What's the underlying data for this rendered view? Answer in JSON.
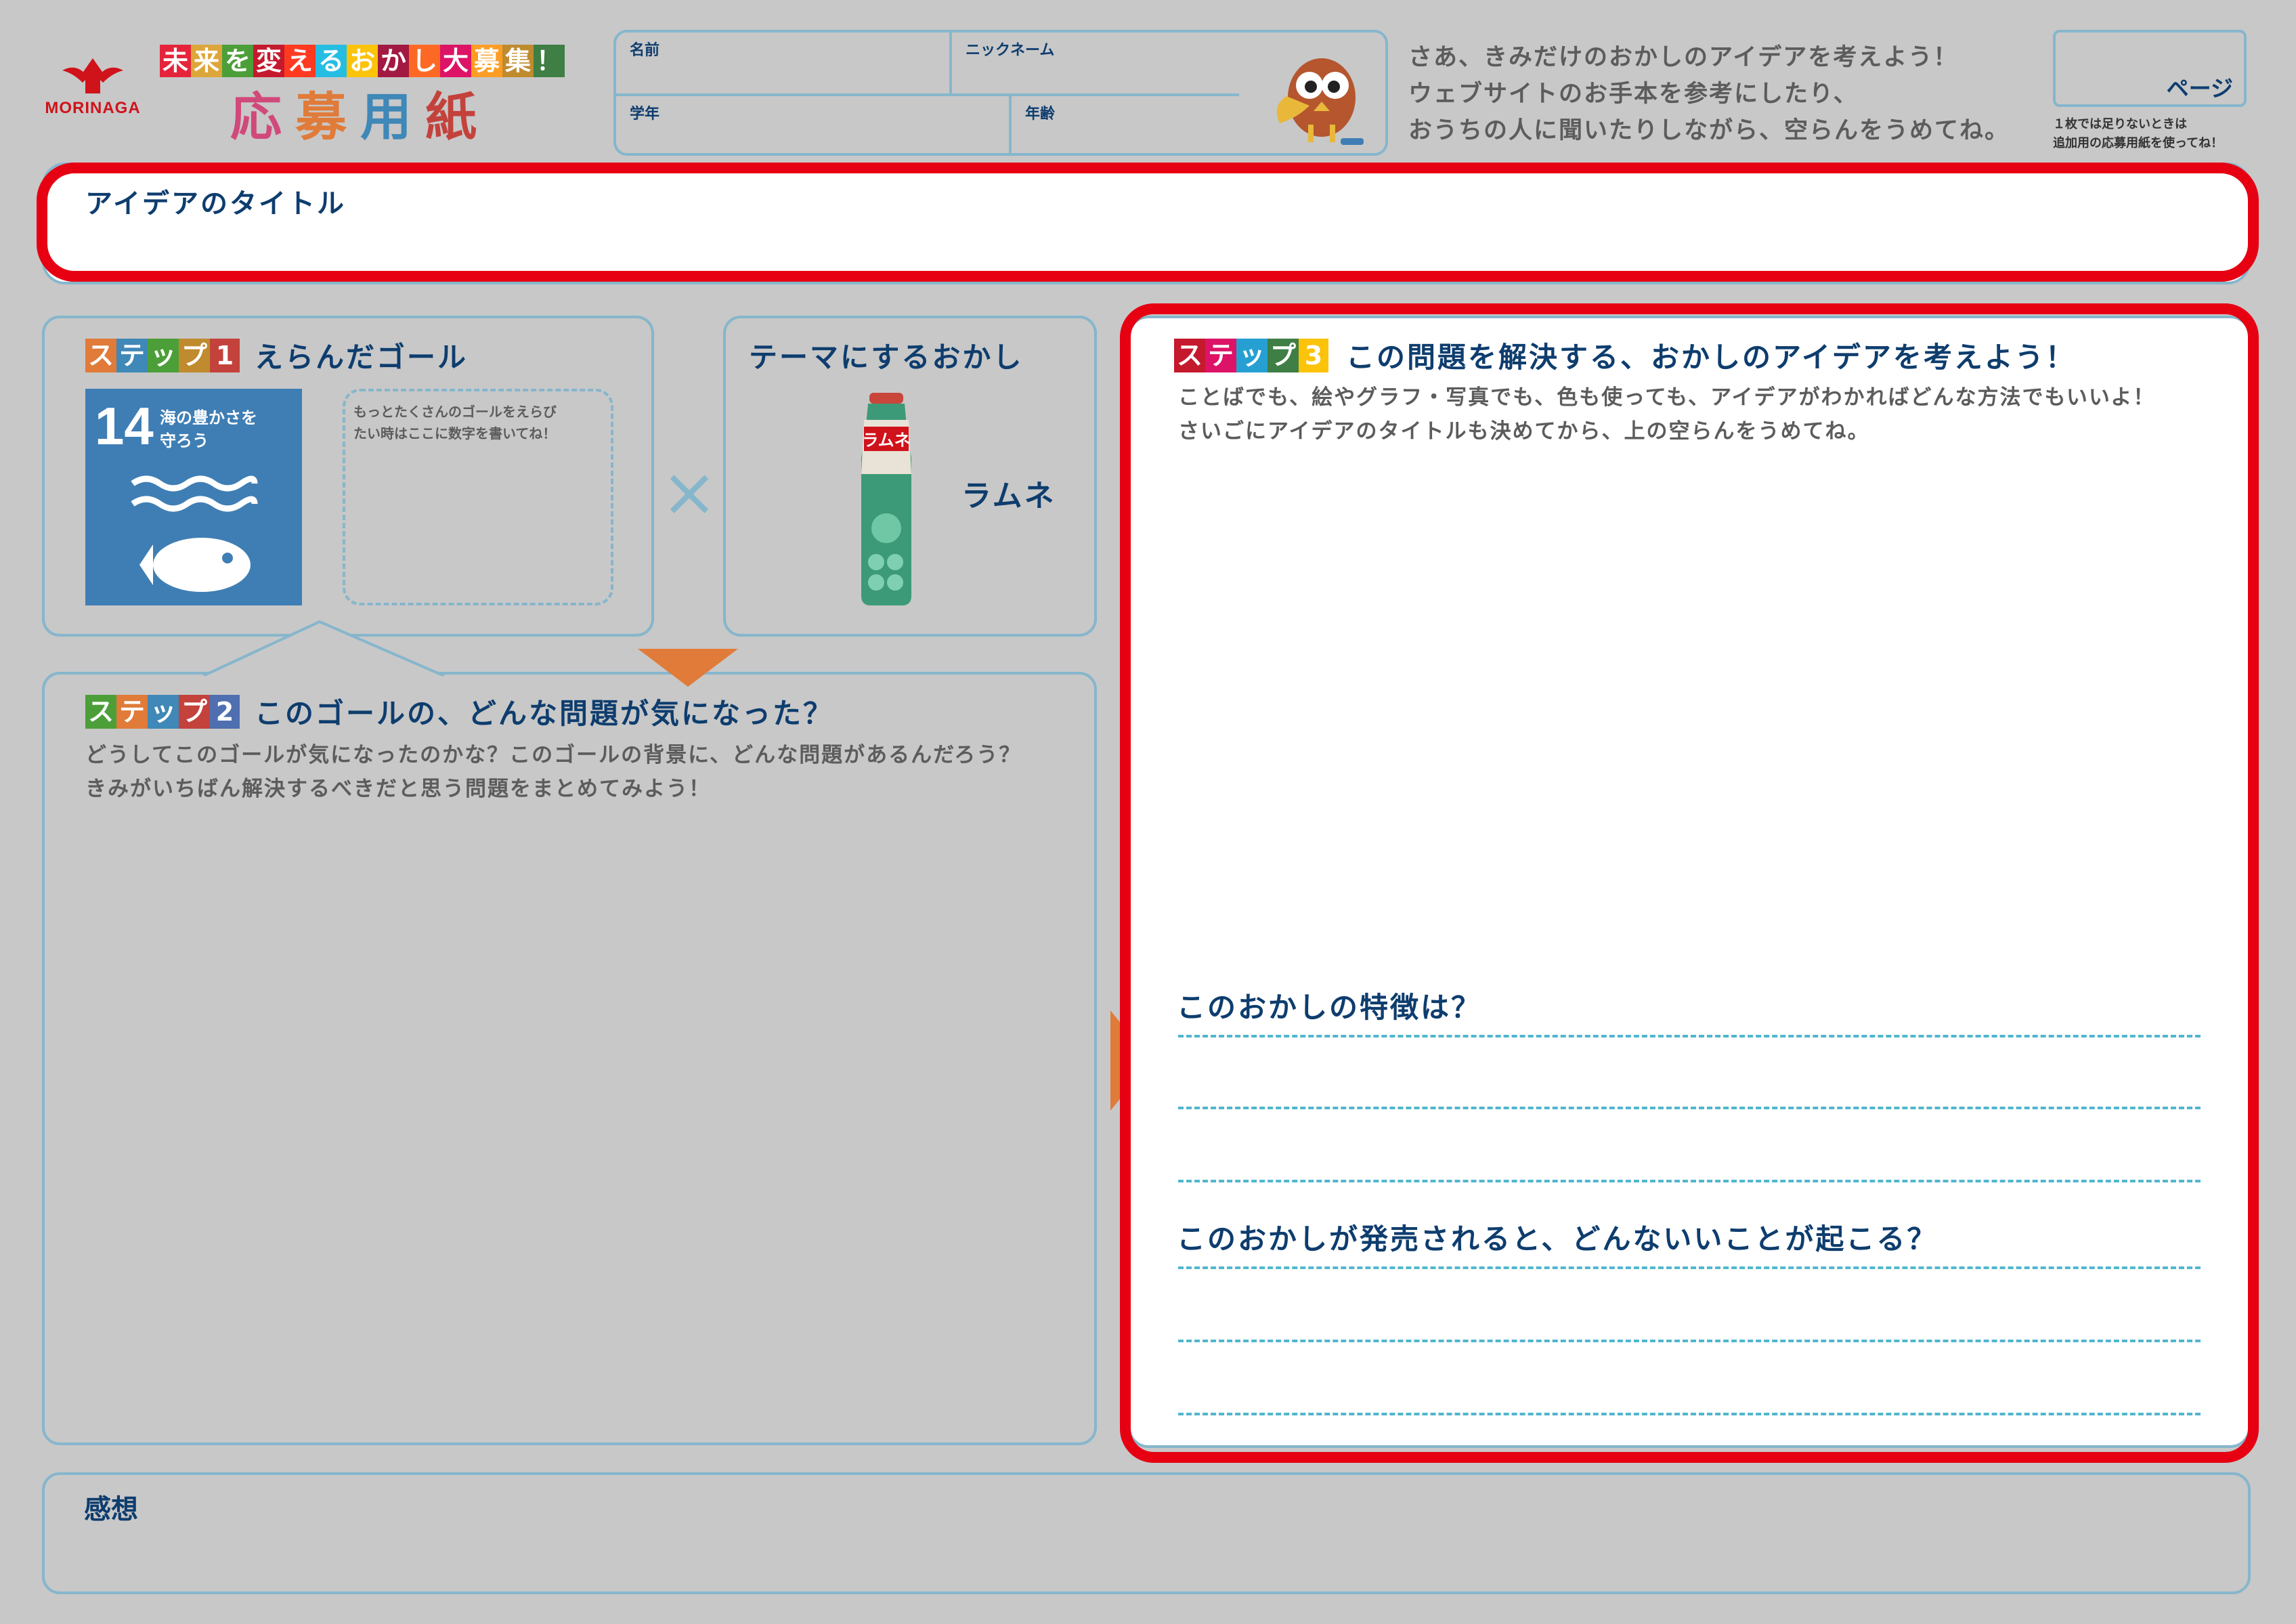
{
  "header": {
    "logo_text": "MORINAGA",
    "campaign_chars": [
      {
        "ch": "未",
        "bg": "#e5243b"
      },
      {
        "ch": "来",
        "bg": "#dda63a"
      },
      {
        "ch": "を",
        "bg": "#4c9f38"
      },
      {
        "ch": "変",
        "bg": "#c5192d"
      },
      {
        "ch": "え",
        "bg": "#ff3a21"
      },
      {
        "ch": "る",
        "bg": "#26bde2"
      },
      {
        "ch": "お",
        "bg": "#fcc30b"
      },
      {
        "ch": "か",
        "bg": "#a21942"
      },
      {
        "ch": "し",
        "bg": "#fd6925"
      },
      {
        "ch": "大",
        "bg": "#dd1367"
      },
      {
        "ch": "募",
        "bg": "#fd9d24"
      },
      {
        "ch": "集",
        "bg": "#bf8b2e"
      },
      {
        "ch": "！",
        "bg": "#3f7e44"
      }
    ],
    "title_chars": [
      {
        "ch": "応",
        "color": "#d1497b"
      },
      {
        "ch": "募",
        "color": "#e07b39"
      },
      {
        "ch": "用",
        "color": "#3f88b8"
      },
      {
        "ch": "紙",
        "color": "#c4423c"
      }
    ],
    "name_label": "名前",
    "nickname_label": "ニックネーム",
    "grade_label": "学年",
    "age_label": "年齢",
    "instructions": [
      "さあ、きみだけのおかしのアイデアを考えよう！",
      "ウェブサイトのお手本を参考にしたり、",
      "おうちの人に聞いたりしながら、空らんをうめてね。"
    ],
    "page_label": "ページ",
    "page_note_1": "１枚では足りないときは",
    "page_note_2": "追加用の応募用紙を使ってね！"
  },
  "idea_title_label": "アイデアのタイトル",
  "step_word": [
    "ス",
    "テ",
    "ッ",
    "プ"
  ],
  "step1": {
    "number": "1",
    "colors": [
      "#e07b39",
      "#3f88b8",
      "#4c9f38",
      "#bf8b2e",
      "#c4423c"
    ],
    "heading": "えらんだゴール",
    "goal_number": "14",
    "goal_line_1": "海の豊かさを",
    "goal_line_2": "守ろう",
    "goal_color": "#3f7eb4",
    "note_line_1": "もっとたくさんのゴールをえらび",
    "note_line_2": "たい時はここに数字を書いてね！"
  },
  "times_symbol": "×",
  "theme": {
    "heading": "テーマにするおかし",
    "product_name": "ラムネ",
    "bottle_label": "ラムネ"
  },
  "step2": {
    "number": "2",
    "colors": [
      "#4c9f38",
      "#e07b39",
      "#3f88b8",
      "#c4423c",
      "#4f6fb0"
    ],
    "heading": "このゴールの、どんな問題が気になった？",
    "desc_1": "どうしてこのゴールが気になったのかな？このゴールの背景に、どんな問題があるんだろう？",
    "desc_2": "きみがいちばん解決するべきだと思う問題をまとめてみよう！"
  },
  "step3": {
    "number": "3",
    "colors": [
      "#c5192d",
      "#dd1367",
      "#26a0d2",
      "#3f7e44",
      "#fcc30b"
    ],
    "heading": "この問題を解決する、おかしのアイデアを考えよう！",
    "desc_1": "ことばでも、絵やグラフ・写真でも、色も使っても、アイデアがわかればどんな方法でもいいよ！",
    "desc_2": "さいごにアイデアのタイトルも決めてから、上の空らんをうめてね。",
    "q1": "このおかしの特徴は？",
    "q2": "このおかしが発売されると、どんないいことが起こる？"
  },
  "impressions_label": "感想",
  "colors": {
    "background": "#c8c8c8",
    "navy": "#0e3d6e",
    "box_border": "#86b6cc",
    "highlight_red": "#e60012",
    "dash_blue": "#51b6cf",
    "arrow_orange": "#e07b39"
  }
}
